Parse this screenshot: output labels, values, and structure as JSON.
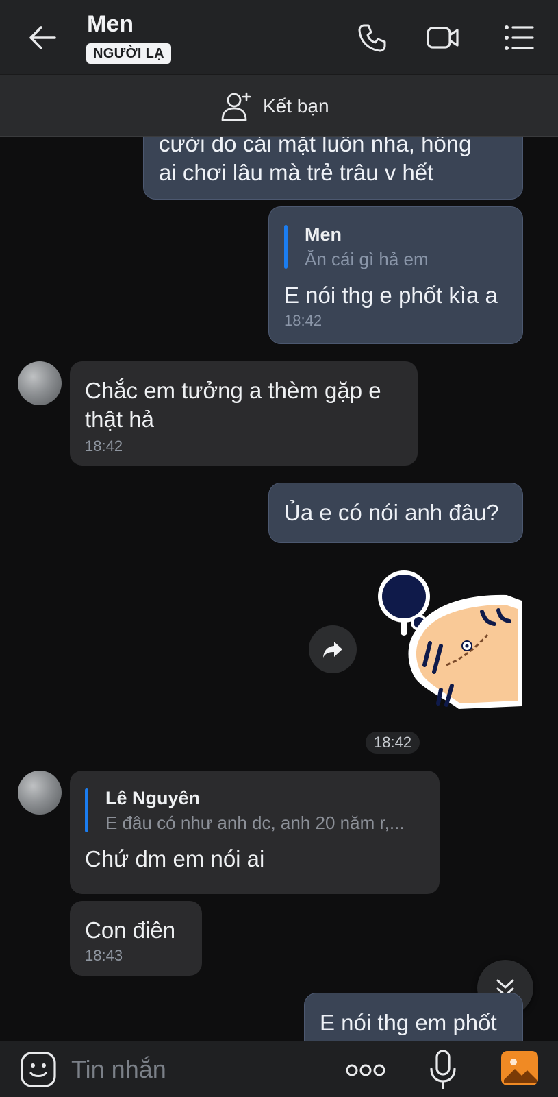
{
  "header": {
    "title": "Men",
    "badge": "NGƯỜI LẠ",
    "add_friend_label": "Kết bạn"
  },
  "messages": {
    "m1": {
      "line1": "cười do cái mặt luôn nha, hông",
      "line2": "ai chơi lâu mà trẻ trâu v hết"
    },
    "m2": {
      "quote_name": "Men",
      "quote_text": "Ăn cái gì hả em",
      "text": "E nói thg e phốt kìa a",
      "time": "18:42"
    },
    "m3": {
      "line1": "Chắc em tưởng a thèm gặp e",
      "line2": "thật hả",
      "time": "18:42"
    },
    "m4": {
      "text": "Ủa e có nói anh đâu?"
    },
    "sticker_time": "18:42",
    "m5": {
      "quote_name": "Lê Nguyên",
      "quote_text": "E đâu có như anh dc, anh 20 năm r,...",
      "text": "Chứ dm em nói ai"
    },
    "m6": {
      "text": "Con điên",
      "time": "18:43"
    },
    "m7": {
      "text": "E nói thg em phốt"
    }
  },
  "input": {
    "placeholder": "Tin nhắn"
  },
  "icons": {
    "back": "arrow-left-icon",
    "call": "phone-icon",
    "video": "video-icon",
    "menu": "list-icon",
    "add_friend": "add-user-icon",
    "forward": "forward-icon",
    "scroll_down": "chevron-double-down-icon",
    "emoji": "emoji-icon",
    "more": "more-icon",
    "mic": "mic-icon",
    "gallery": "image-icon"
  },
  "colors": {
    "outgoing_bubble": "#3a4455",
    "incoming_bubble": "#2b2b2d",
    "quote_bar": "#1b7df0",
    "gallery_icon": "#f08a24"
  }
}
